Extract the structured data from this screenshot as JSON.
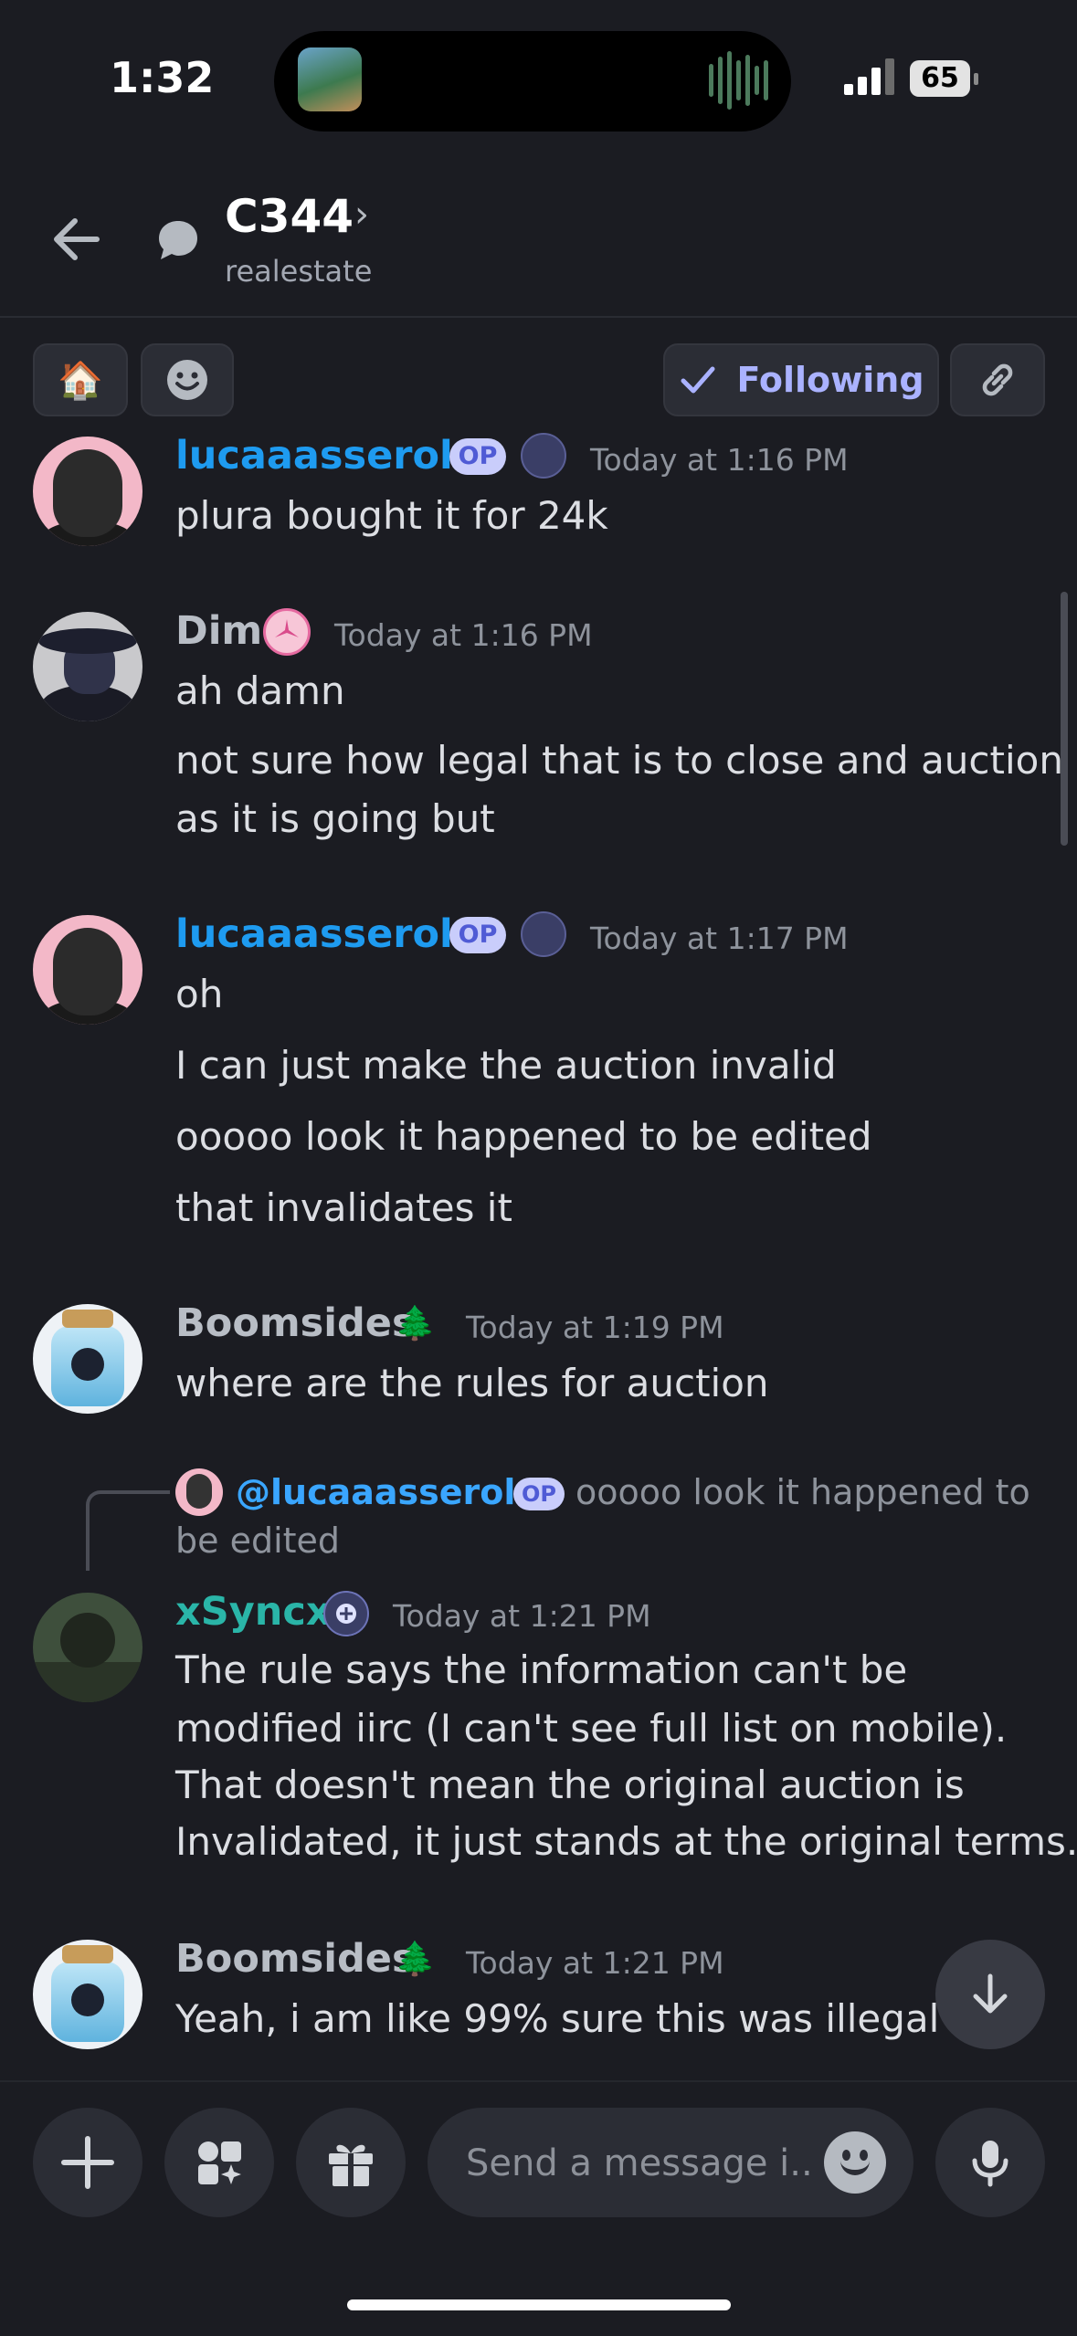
{
  "status_bar": {
    "time": "1:32",
    "battery": "65"
  },
  "header": {
    "title": "C344",
    "subtitle": "realestate"
  },
  "chips": {
    "emoji_tag": "🏠",
    "following_label": "Following"
  },
  "messages": [
    {
      "author": "lucaaasserole",
      "badge": "OP",
      "time": "Today at 1:16 PM",
      "lines": [
        "plura bought it for 24k"
      ]
    },
    {
      "author": "Dim",
      "time": "Today at 1:16 PM",
      "lines": [
        "ah damn",
        "not sure how legal that is to close and auction",
        "as it is going but"
      ]
    },
    {
      "author": "lucaaasserole",
      "badge": "OP",
      "time": "Today at 1:17 PM",
      "lines": [
        "oh",
        "I can just make the auction invalid",
        "ooooo look it happened to be edited",
        "that invalidates it"
      ]
    },
    {
      "author": "Boomsides",
      "emoji": "🌲",
      "time": "Today at 1:19 PM",
      "lines": [
        "where are the rules for auction"
      ]
    },
    {
      "author": "xSyncx",
      "time": "Today at 1:21 PM",
      "reply": {
        "mention": "@lucaaasserole",
        "badge": "OP",
        "text_1": "ooooo look it happened to",
        "text_2": "be edited"
      },
      "lines": [
        "The rule says the information can't be",
        "modified iirc (I can't see full list on mobile).",
        "That doesn't mean the original auction is",
        "Invalidated, it just stands at the original terms."
      ]
    },
    {
      "author": "Boomsides",
      "emoji": "🌲",
      "time": "Today at 1:21 PM",
      "lines": [
        "Yeah, i am like 99% sure this was illegal"
      ]
    }
  ],
  "composer": {
    "placeholder": "Send a message i.."
  }
}
